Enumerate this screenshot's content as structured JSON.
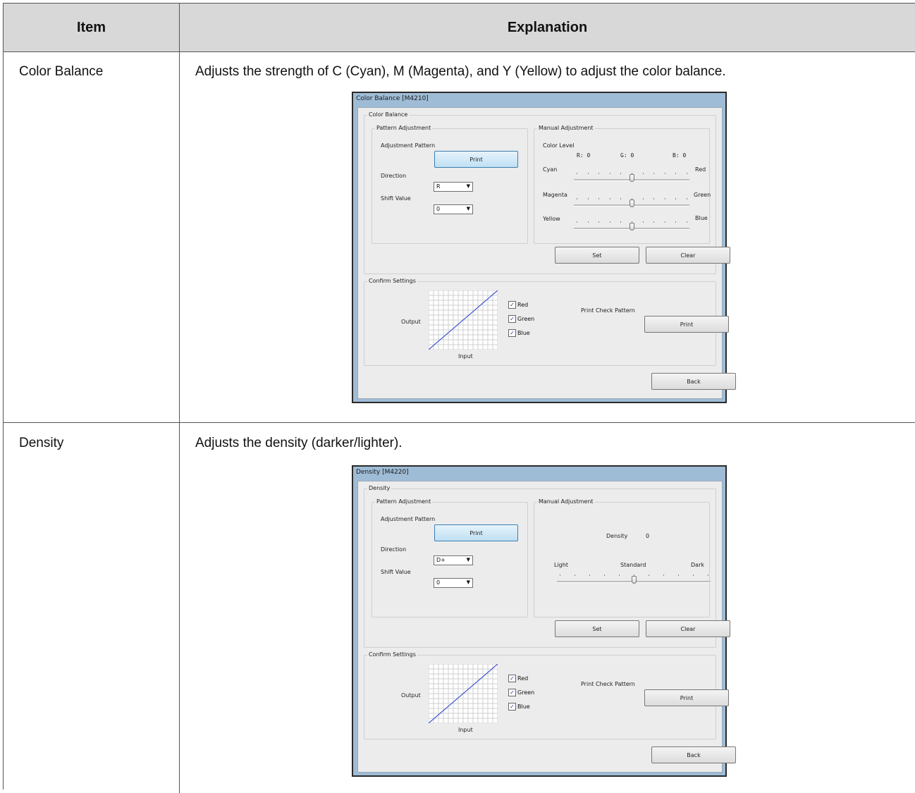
{
  "table": {
    "header": {
      "item": "Item",
      "explanation": "Explanation"
    },
    "rows": [
      {
        "item": "Color Balance",
        "explanation": "Adjusts the strength of C (Cyan), M (Magenta), and Y (Yellow) to adjust the color balance.",
        "dialog": {
          "title": "Color Balance [M4210]",
          "group": "Color Balance",
          "pattern_adjustment": "Pattern Adjustment",
          "adjustment_pattern": "Adjustment Pattern",
          "print": "Print",
          "direction": "Direction",
          "direction_value": "R",
          "shift_value": "Shift Value",
          "shift_value_value": "0",
          "manual_adjustment": "Manual Adjustment",
          "color_level": "Color Level",
          "r_readout": "R: 0",
          "g_readout": "G: 0",
          "b_readout": "B: 0",
          "sliders": [
            {
              "left": "Cyan",
              "right": "Red",
              "value": 0.5
            },
            {
              "left": "Magenta",
              "right": "Green",
              "value": 0.5
            },
            {
              "left": "Yellow",
              "right": "Blue",
              "value": 0.5
            }
          ],
          "set": "Set",
          "clear": "Clear",
          "confirm_settings": "Confirm Settings",
          "output": "Output",
          "input": "Input",
          "checkboxes": [
            "Red",
            "Green",
            "Blue"
          ],
          "print_check_pattern": "Print Check Pattern",
          "back": "Back"
        }
      },
      {
        "item": "Density",
        "explanation": "Adjusts the density (darker/lighter).",
        "dialog": {
          "title": "Density [M4220]",
          "group": "Density",
          "pattern_adjustment": "Pattern Adjustment",
          "adjustment_pattern": "Adjustment Pattern",
          "print": "Print",
          "direction": "Direction",
          "direction_value": "D+",
          "shift_value": "Shift Value",
          "shift_value_value": "0",
          "manual_adjustment": "Manual Adjustment",
          "density_label": "Density",
          "density_value": "0",
          "light": "Light",
          "standard": "Standard",
          "dark": "Dark",
          "density_slider_value": 0.5,
          "set": "Set",
          "clear": "Clear",
          "confirm_settings": "Confirm Settings",
          "output": "Output",
          "input": "Input",
          "checkboxes": [
            "Red",
            "Green",
            "Blue"
          ],
          "print_check_pattern": "Print Check Pattern",
          "back": "Back"
        }
      }
    ]
  },
  "colors": {
    "header_bg": "#d8d8d8",
    "window_frame": "#9fbcd6",
    "dialog_bg": "#ececec",
    "curve": "#3b4fd1"
  },
  "icons": {
    "checkbox_checked": "check-icon",
    "combo_arrow": "chevron-down-icon"
  }
}
